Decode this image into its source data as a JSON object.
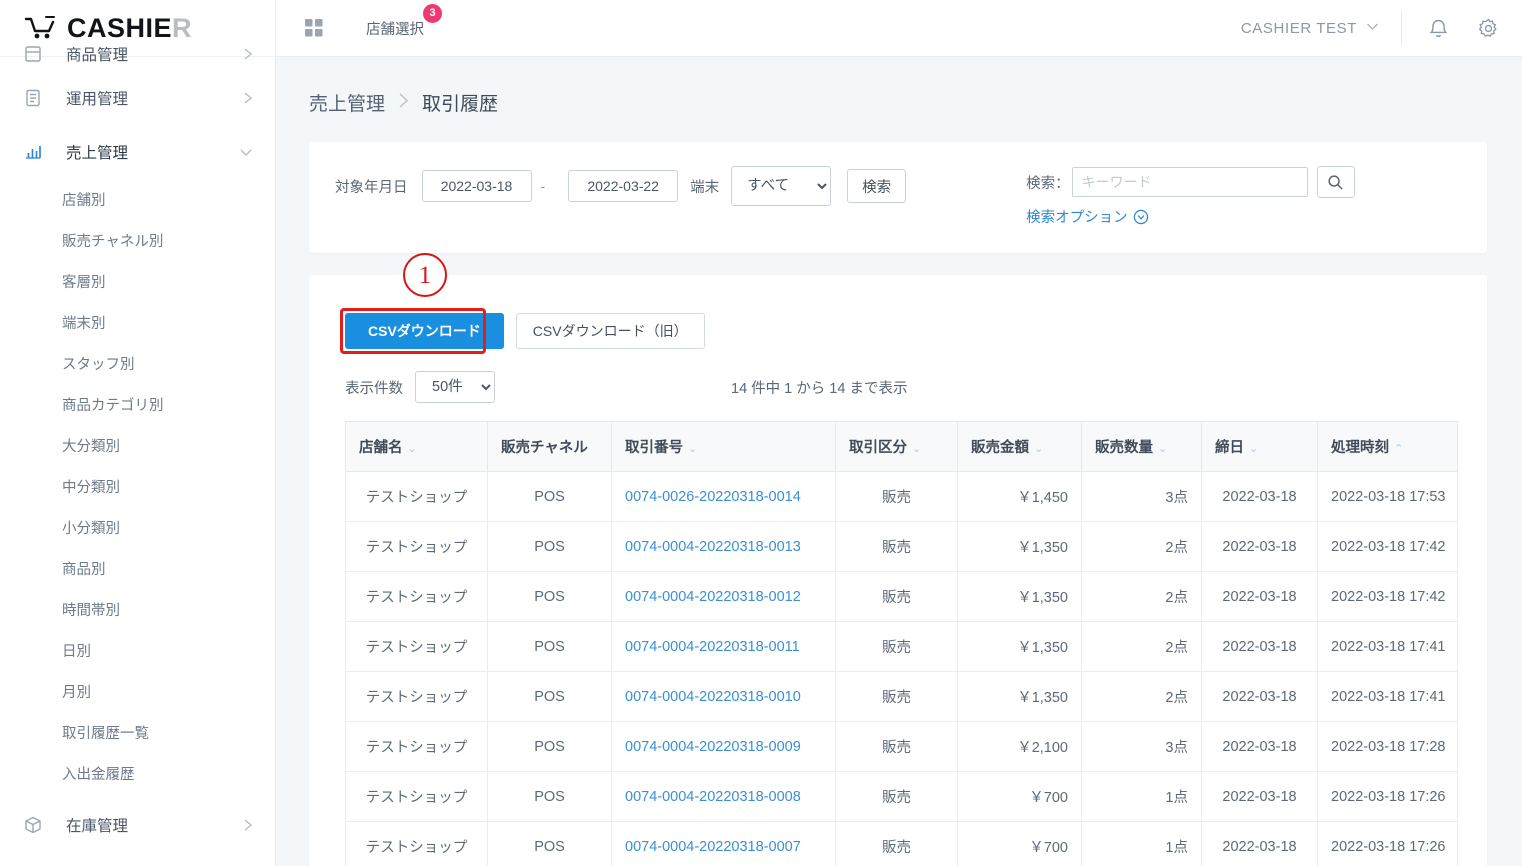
{
  "brand": {
    "name_main": "CASHIE",
    "name_accent": "R"
  },
  "topbar": {
    "grid_icon": "grid-icon",
    "store_select_label": "店舗選択",
    "store_select_badge": "3",
    "user_name": "CASHIER TEST",
    "bell_icon": "bell-icon",
    "gear_icon": "gear-icon"
  },
  "sidebar": {
    "groups": [
      {
        "label": "商品管理",
        "icon": "tag-icon",
        "state": "collapsed",
        "clipped": true
      },
      {
        "label": "運用管理",
        "icon": "clipboard-icon",
        "state": "collapsed",
        "clipped": false
      },
      {
        "label": "売上管理",
        "icon": "bar-chart-icon",
        "state": "expanded",
        "clipped": false
      }
    ],
    "sub_items": [
      "店舗別",
      "販売チャネル別",
      "客層別",
      "端末別",
      "スタッフ別",
      "商品カテゴリ別",
      "大分類別",
      "中分類別",
      "小分類別",
      "商品別",
      "時間帯別",
      "日別",
      "月別",
      "取引履歴一覧",
      "入出金履歴"
    ],
    "bottom_group": {
      "label": "在庫管理",
      "icon": "box-icon",
      "state": "collapsed"
    }
  },
  "breadcrumb": {
    "parent": "売上管理",
    "separator": "›",
    "current": "取引履歴"
  },
  "search_panel": {
    "date_label": "対象年月日",
    "date_from": "2022-03-18",
    "date_to": "2022-03-22",
    "date_separator": "-",
    "terminal_label": "端末",
    "terminal_value": "すべて",
    "terminal_options": [
      "すべて"
    ],
    "search_button": "検索",
    "keyword_label": "検索：",
    "keyword_value": "",
    "keyword_placeholder": "キーワード",
    "search_icon": "magnifier-icon",
    "options_link": "検索オプション",
    "options_icon": "chevron-down-circle-icon"
  },
  "toolbar": {
    "csv_download": "CSVダウンロード",
    "csv_download_old": "CSVダウンロード（旧）",
    "annotation_number": "①",
    "annotation_number_plain": "1",
    "highlight_color": "#e21f1f"
  },
  "listing": {
    "rows_label": "表示件数",
    "rows_value": "50件",
    "rows_options": [
      "50件"
    ],
    "count_info": "14 件中 1 から 14 まで表示"
  },
  "table": {
    "columns": [
      {
        "label": "店舗名",
        "sort": "down",
        "align": "left"
      },
      {
        "label": "販売チャネル",
        "sort": "",
        "align": "left"
      },
      {
        "label": "取引番号",
        "sort": "down",
        "align": "left"
      },
      {
        "label": "取引区分",
        "sort": "down",
        "align": "left"
      },
      {
        "label": "販売金額",
        "sort": "down",
        "align": "left"
      },
      {
        "label": "販売数量",
        "sort": "down",
        "align": "left"
      },
      {
        "label": "締日",
        "sort": "down",
        "align": "left"
      },
      {
        "label": "処理時刻",
        "sort": "up",
        "align": "left"
      }
    ],
    "rows": [
      {
        "shop": "テストショップ",
        "channel": "POS",
        "txno": "0074-0026-20220318-0014",
        "kbn": "販売",
        "amount": "￥1,450",
        "qty": "3点",
        "close_date": "2022-03-18",
        "processed": "2022-03-18 17:53"
      },
      {
        "shop": "テストショップ",
        "channel": "POS",
        "txno": "0074-0004-20220318-0013",
        "kbn": "販売",
        "amount": "￥1,350",
        "qty": "2点",
        "close_date": "2022-03-18",
        "processed": "2022-03-18 17:42"
      },
      {
        "shop": "テストショップ",
        "channel": "POS",
        "txno": "0074-0004-20220318-0012",
        "kbn": "販売",
        "amount": "￥1,350",
        "qty": "2点",
        "close_date": "2022-03-18",
        "processed": "2022-03-18 17:42"
      },
      {
        "shop": "テストショップ",
        "channel": "POS",
        "txno": "0074-0004-20220318-0011",
        "kbn": "販売",
        "amount": "￥1,350",
        "qty": "2点",
        "close_date": "2022-03-18",
        "processed": "2022-03-18 17:41"
      },
      {
        "shop": "テストショップ",
        "channel": "POS",
        "txno": "0074-0004-20220318-0010",
        "kbn": "販売",
        "amount": "￥1,350",
        "qty": "2点",
        "close_date": "2022-03-18",
        "processed": "2022-03-18 17:41"
      },
      {
        "shop": "テストショップ",
        "channel": "POS",
        "txno": "0074-0004-20220318-0009",
        "kbn": "販売",
        "amount": "￥2,100",
        "qty": "3点",
        "close_date": "2022-03-18",
        "processed": "2022-03-18 17:28"
      },
      {
        "shop": "テストショップ",
        "channel": "POS",
        "txno": "0074-0004-20220318-0008",
        "kbn": "販売",
        "amount": "￥700",
        "qty": "1点",
        "close_date": "2022-03-18",
        "processed": "2022-03-18 17:26"
      },
      {
        "shop": "テストショップ",
        "channel": "POS",
        "txno": "0074-0004-20220318-0007",
        "kbn": "販売",
        "amount": "￥700",
        "qty": "1点",
        "close_date": "2022-03-18",
        "processed": "2022-03-18 17:26"
      }
    ]
  },
  "colors": {
    "primary": "#1a8fe0",
    "link": "#3b8fd4",
    "status_ok": "#3cb878",
    "badge": "#ec3a72",
    "annotation": "#d81515",
    "page_bg": "#f4f7fa"
  }
}
